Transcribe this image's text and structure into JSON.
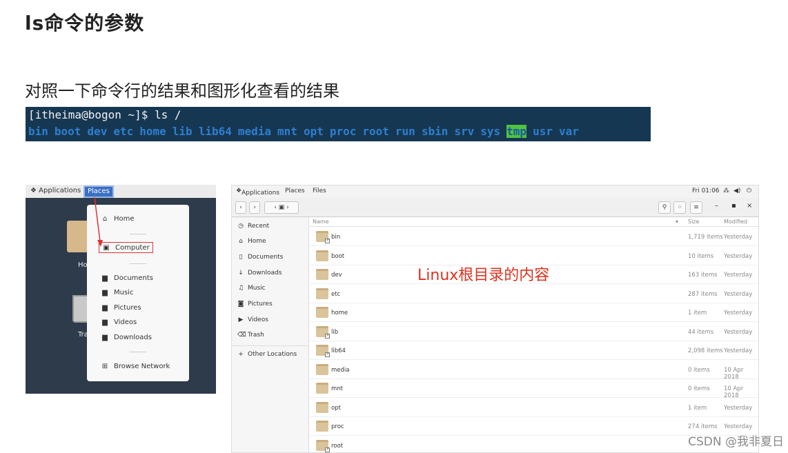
{
  "page": {
    "title": "ls命令的参数",
    "subtitle": "对照一下命令行的结果和图形化查看的结果",
    "annotation": "Linux根目录的内容",
    "watermark": "CSDN @我非夏日"
  },
  "terminal": {
    "prompt": "[itheima@bogon ~]$ ls /",
    "dirs": [
      "bin",
      "boot",
      "dev",
      "etc",
      "home",
      "lib",
      "lib64",
      "media",
      "mnt",
      "opt",
      "proc",
      "root",
      "run",
      "sbin",
      "srv",
      "sys",
      "tmp",
      "usr",
      "var"
    ]
  },
  "left_shot": {
    "topbar": {
      "applications": "Applications",
      "places": "Places"
    },
    "desktop": {
      "home_label": "Ho",
      "trash_label": "Tra"
    },
    "menu": {
      "home": "Home",
      "computer": "Computer",
      "documents": "Documents",
      "music": "Music",
      "pictures": "Pictures",
      "videos": "Videos",
      "downloads": "Downloads",
      "browse_network": "Browse Network"
    }
  },
  "right_shot": {
    "topbar": {
      "applications": "Applications",
      "places": "Places",
      "files": "Files",
      "clock": "Fri 01:06"
    },
    "sidebar": {
      "recent": "Recent",
      "home": "Home",
      "documents": "Documents",
      "downloads": "Downloads",
      "music": "Music",
      "pictures": "Pictures",
      "videos": "Videos",
      "trash": "Trash",
      "other": "Other Locations"
    },
    "columns": {
      "name": "Name",
      "size": "Size",
      "modified": "Modified"
    },
    "rows": [
      {
        "name": "bin",
        "size": "1,719 items",
        "modified": "Yesterday",
        "link": true
      },
      {
        "name": "boot",
        "size": "10 items",
        "modified": "Yesterday",
        "link": false
      },
      {
        "name": "dev",
        "size": "163 items",
        "modified": "Yesterday",
        "link": false
      },
      {
        "name": "etc",
        "size": "287 items",
        "modified": "Yesterday",
        "link": false
      },
      {
        "name": "home",
        "size": "1 item",
        "modified": "Yesterday",
        "link": false
      },
      {
        "name": "lib",
        "size": "44 items",
        "modified": "Yesterday",
        "link": true
      },
      {
        "name": "lib64",
        "size": "2,098 items",
        "modified": "Yesterday",
        "link": true
      },
      {
        "name": "media",
        "size": "0 items",
        "modified": "10 Apr 2018",
        "link": false
      },
      {
        "name": "mnt",
        "size": "0 items",
        "modified": "10 Apr 2018",
        "link": false
      },
      {
        "name": "opt",
        "size": "1 item",
        "modified": "Yesterday",
        "link": false
      },
      {
        "name": "proc",
        "size": "274 items",
        "modified": "Yesterday",
        "link": false
      },
      {
        "name": "root",
        "size": "",
        "modified": "",
        "link": true
      }
    ]
  },
  "colors": {
    "terminal_bg": "#163752",
    "dir_blue": "#2e7fd0",
    "tmp_bg": "#4ec43f",
    "highlight_red": "#e0301e"
  }
}
